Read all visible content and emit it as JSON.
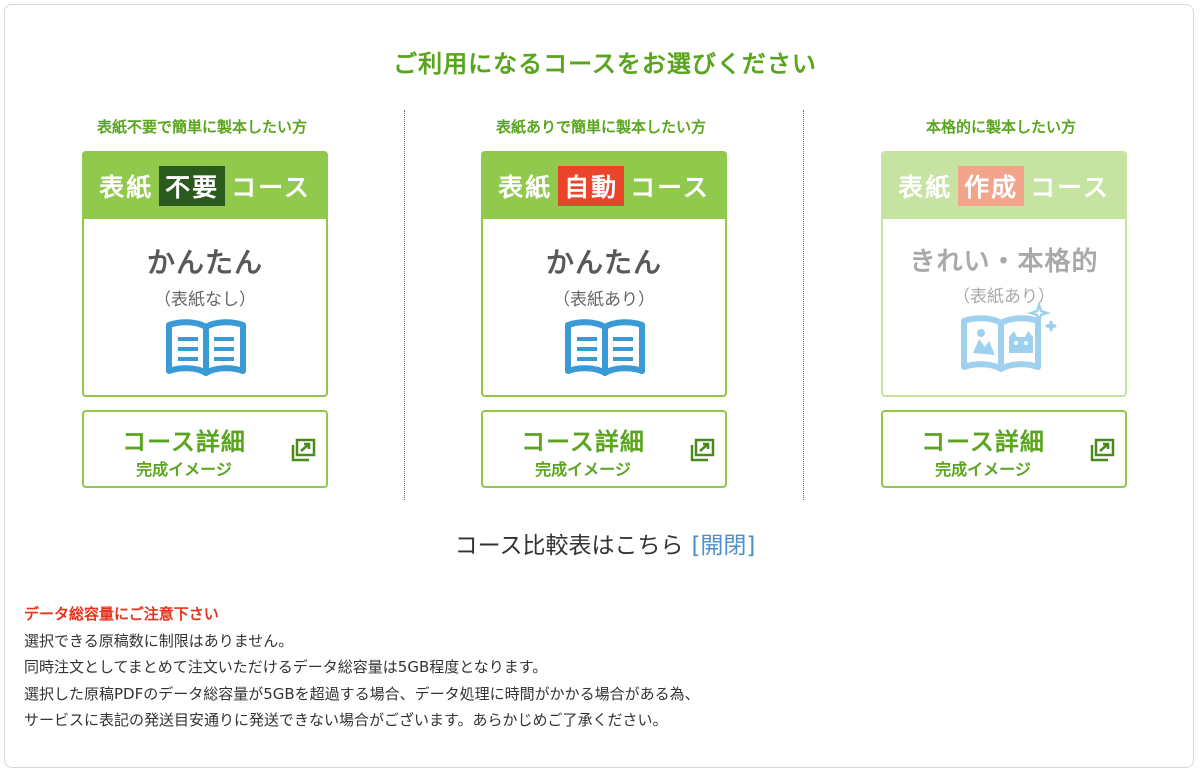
{
  "title": "ご利用になるコースをお選びください",
  "courses": [
    {
      "subtitle": "表紙不要で簡単に製本したい方",
      "header_pre": "表紙",
      "header_highlight": "不要",
      "header_post": "コース",
      "main_text": "かんたん",
      "paren_text": "（表紙なし）",
      "icon": "open-book-icon",
      "detail_label": "コース詳細",
      "detail_sub": "完成イメージ"
    },
    {
      "subtitle": "表紙ありで簡単に製本したい方",
      "header_pre": "表紙",
      "header_highlight": "自動",
      "header_post": "コース",
      "main_text": "かんたん",
      "paren_text": "（表紙あり）",
      "icon": "open-book-icon",
      "detail_label": "コース詳細",
      "detail_sub": "完成イメージ"
    },
    {
      "subtitle": "本格的に製本したい方",
      "header_pre": "表紙",
      "header_highlight": "作成",
      "header_post": "コース",
      "main_text": "きれい・本格的",
      "paren_text": "（表紙あり）",
      "icon": "picture-book-icon",
      "detail_label": "コース詳細",
      "detail_sub": "完成イメージ"
    }
  ],
  "compare": {
    "label": "コース比較表はこちら",
    "toggle": "[開閉]"
  },
  "notice": {
    "heading": "データ総容量にご注意下さい",
    "lines": [
      "選択できる原稿数に制限はありません。",
      "同時注文としてまとめて注文いただけるデータ総容量は5GB程度となります。",
      "選択した原稿PDFのデータ総容量が5GBを超過する場合、データ処理に時間がかかる場合がある為、",
      "サービスに表記の発送目安通りに発送できない場合がございます。あらかじめご了承ください。"
    ]
  },
  "colors": {
    "green": "#5aa51e",
    "header_green": "#91c94d",
    "highlight_dark": "#2b5a1e",
    "highlight_red": "#e8452a",
    "highlight_salmon": "#f2a58a",
    "link_blue": "#4e8fc9",
    "warning_red": "#e8331c"
  }
}
